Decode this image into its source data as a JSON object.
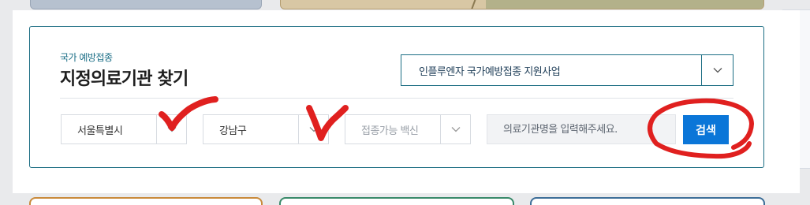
{
  "search": {
    "subtitle": "국가 예방접종",
    "title": "지정의료기관 찾기",
    "program_select": {
      "value": "인플루엔자 국가예방접종 지원사업"
    },
    "city_select": {
      "value": "서울특별시"
    },
    "district_select": {
      "value": "강남구"
    },
    "vaccine_select": {
      "value": "접종가능 백신"
    },
    "name_input": {
      "placeholder": "의료기관명을 입력해주세요."
    },
    "search_button": {
      "label": "검색"
    }
  },
  "colors": {
    "accent": "#1d6e84",
    "button": "#0b76d8",
    "annotation": "#e0201f"
  },
  "icons": {
    "select_arrow": "chevron-down-icon"
  }
}
